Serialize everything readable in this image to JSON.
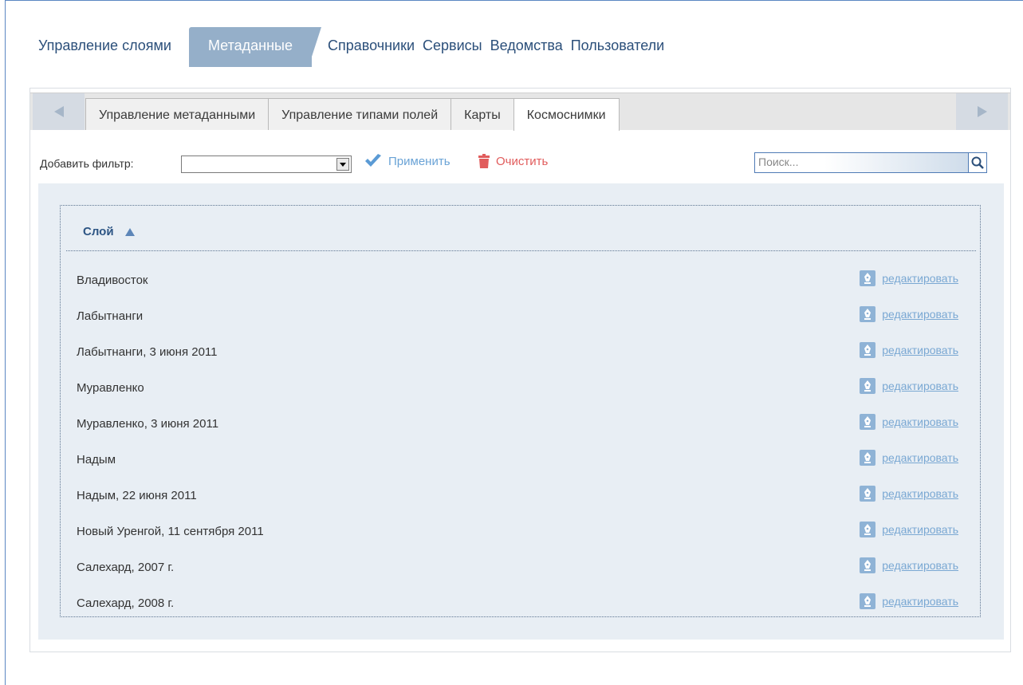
{
  "main_nav": {
    "items": [
      {
        "label": "Управление слоями",
        "active": false
      },
      {
        "label": "Метаданные",
        "active": true
      },
      {
        "label": "Справочники",
        "active": false
      },
      {
        "label": "Сервисы",
        "active": false
      },
      {
        "label": "Ведомства",
        "active": false
      },
      {
        "label": "Пользователи",
        "active": false
      }
    ]
  },
  "subtabs": {
    "items": [
      {
        "label": "Управление метаданными"
      },
      {
        "label": "Управление типами полей"
      },
      {
        "label": "Карты"
      },
      {
        "label": "Космоснимки"
      }
    ],
    "active_label": "Космоснимки"
  },
  "filter": {
    "label": "Добавить фильтр:",
    "selected": "",
    "apply_label": "Применить",
    "clear_label": "Очистить"
  },
  "search": {
    "placeholder": "Поиск..."
  },
  "grid": {
    "column_header": "Слой",
    "sort": "ascending",
    "action_label": "редактировать",
    "rows": [
      "Владивосток",
      "Лабытнанги",
      "Лабытнанги, 3 июня 2011",
      "Муравленко",
      "Муравленко, 3 июня 2011",
      "Надым",
      "Надым, 22 июня 2011",
      "Новый Уренгой, 11 сентября 2011",
      "Салехард, 2007 г.",
      "Салехард, 2008 г."
    ]
  },
  "colors": {
    "accent": "#95afc9",
    "link": "#7aa8d3",
    "apply": "#6aa3d6",
    "clear": "#e15c5c",
    "content_bg": "#e8eef4"
  }
}
